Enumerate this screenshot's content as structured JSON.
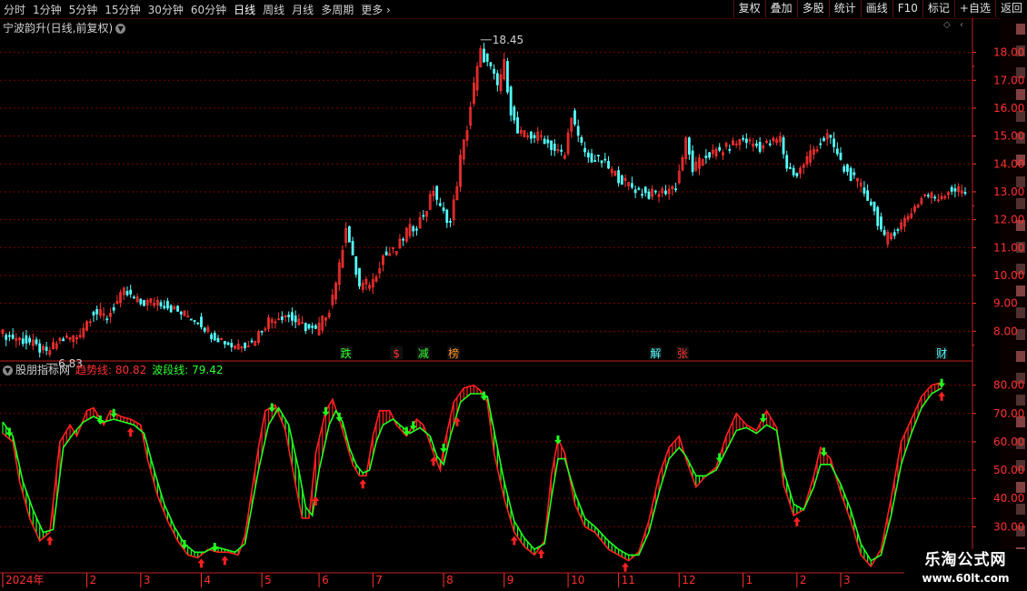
{
  "toolbar": {
    "periods": [
      "分时",
      "1分钟",
      "5分钟",
      "15分钟",
      "30分钟",
      "60分钟",
      "日线",
      "周线",
      "月线",
      "多周期",
      "更多"
    ],
    "active_period": "日线",
    "right_buttons": [
      "复权",
      "叠加",
      "多股",
      "统计",
      "画线",
      "F10",
      "标记",
      "+自选",
      "返回"
    ]
  },
  "main_chart": {
    "title": "宁波韵升(日线,前复权)",
    "max_label": "18.45",
    "min_label": "6.83"
  },
  "sub_chart": {
    "name": "股朋指标网",
    "line1_label": "趋势线:",
    "line1_value": "80.82",
    "line2_label": "波段线:",
    "line2_value": "79.42"
  },
  "logo": {
    "line1": "乐淘公式网",
    "line2": "www.60lt.com"
  },
  "colors": {
    "up": "#ff3232",
    "down": "#54ffff",
    "trend": "#ff2020",
    "wave": "#20ff20",
    "grid": "#800000",
    "axis": "#ff3030"
  },
  "chart_data": [
    {
      "type": "candlestick",
      "title": "宁波韵升(日线,前复权)",
      "y_ticks": [
        8.0,
        9.0,
        10.0,
        11.0,
        12.0,
        13.0,
        14.0,
        15.0,
        16.0,
        17.0,
        18.0
      ],
      "ylim": [
        7.0,
        18.9
      ],
      "annotations": [
        {
          "text": "跌",
          "color": "#30ff30",
          "index": 102
        },
        {
          "text": "$",
          "color": "#ff3030",
          "index": 117
        },
        {
          "text": "减",
          "color": "#30ff30",
          "index": 125
        },
        {
          "text": "榜",
          "color": "#ff9020",
          "index": 134
        },
        {
          "text": "解",
          "color": "#54ffff",
          "index": 194
        },
        {
          "text": "张",
          "color": "#ff3030",
          "index": 202
        },
        {
          "text": "财",
          "color": "#54ffff",
          "index": 279
        }
      ],
      "x_labels": [
        {
          "text": "2024年",
          "index": 0
        },
        {
          "text": "2",
          "index": 25
        },
        {
          "text": "3",
          "index": 41
        },
        {
          "text": "4",
          "index": 59
        },
        {
          "text": "5",
          "index": 77
        },
        {
          "text": "6",
          "index": 94
        },
        {
          "text": "7",
          "index": 110
        },
        {
          "text": "8",
          "index": 131
        },
        {
          "text": "9",
          "index": 149
        },
        {
          "text": "10",
          "index": 168
        },
        {
          "text": "11",
          "index": 183
        },
        {
          "text": "12",
          "index": 201
        },
        {
          "text": "1",
          "index": 220
        },
        {
          "text": "2",
          "index": 236
        },
        {
          "text": "3",
          "index": 249
        }
      ],
      "close_keypoints": [
        [
          0,
          7.9
        ],
        [
          8,
          7.6
        ],
        [
          13,
          7.2
        ],
        [
          17,
          7.7
        ],
        [
          22,
          7.8
        ],
        [
          27,
          8.7
        ],
        [
          31,
          8.5
        ],
        [
          36,
          9.4
        ],
        [
          41,
          9.0
        ],
        [
          46,
          9.1
        ],
        [
          52,
          8.7
        ],
        [
          58,
          8.4
        ],
        [
          62,
          7.9
        ],
        [
          68,
          7.5
        ],
        [
          74,
          7.6
        ],
        [
          79,
          8.4
        ],
        [
          84,
          8.6
        ],
        [
          89,
          8.2
        ],
        [
          93,
          8.0
        ],
        [
          97,
          8.8
        ],
        [
          100,
          10.3
        ],
        [
          102,
          11.8
        ],
        [
          104,
          10.6
        ],
        [
          106,
          9.6
        ],
        [
          110,
          9.8
        ],
        [
          113,
          10.7
        ],
        [
          117,
          10.9
        ],
        [
          120,
          11.6
        ],
        [
          123,
          11.8
        ],
        [
          126,
          12.4
        ],
        [
          128,
          13.1
        ],
        [
          130,
          12.4
        ],
        [
          133,
          11.9
        ],
        [
          135,
          13.3
        ],
        [
          136,
          14.2
        ],
        [
          138,
          15.3
        ],
        [
          140,
          16.8
        ],
        [
          142,
          18.0
        ],
        [
          145,
          17.4
        ],
        [
          147,
          16.8
        ],
        [
          149,
          17.6
        ],
        [
          151,
          15.9
        ],
        [
          153,
          15.1
        ],
        [
          156,
          15.0
        ],
        [
          160,
          15.0
        ],
        [
          164,
          14.5
        ],
        [
          167,
          14.3
        ],
        [
          169,
          15.8
        ],
        [
          171,
          14.9
        ],
        [
          174,
          14.2
        ],
        [
          178,
          14.1
        ],
        [
          183,
          13.5
        ],
        [
          188,
          13.1
        ],
        [
          192,
          12.9
        ],
        [
          196,
          13.0
        ],
        [
          200,
          13.2
        ],
        [
          203,
          14.8
        ],
        [
          205,
          13.8
        ],
        [
          209,
          14.3
        ],
        [
          214,
          14.5
        ],
        [
          220,
          14.9
        ],
        [
          225,
          14.6
        ],
        [
          231,
          14.9
        ],
        [
          233,
          13.9
        ],
        [
          236,
          13.6
        ],
        [
          240,
          14.4
        ],
        [
          245,
          15.0
        ],
        [
          247,
          14.6
        ],
        [
          250,
          13.8
        ],
        [
          255,
          13.2
        ],
        [
          258,
          12.6
        ],
        [
          262,
          11.3
        ],
        [
          266,
          11.7
        ],
        [
          270,
          12.3
        ],
        [
          274,
          12.9
        ],
        [
          278,
          12.8
        ],
        [
          282,
          13.1
        ],
        [
          286,
          13.0
        ]
      ]
    },
    {
      "type": "line",
      "title": "股朋指标网",
      "series": [
        {
          "name": "趋势线",
          "last": 80.82
        },
        {
          "name": "波段线",
          "last": 79.42
        }
      ],
      "y_ticks": [
        30.0,
        40.0,
        50.0,
        60.0,
        70.0,
        80.0
      ],
      "ylim": [
        15,
        86
      ],
      "trend_keypoints": [
        [
          0,
          63
        ],
        [
          3,
          60
        ],
        [
          5,
          46
        ],
        [
          8,
          33
        ],
        [
          11,
          25
        ],
        [
          14,
          28
        ],
        [
          17,
          60
        ],
        [
          20,
          66
        ],
        [
          22,
          62
        ],
        [
          25,
          71
        ],
        [
          27,
          72
        ],
        [
          30,
          66
        ],
        [
          32,
          71
        ],
        [
          35,
          69
        ],
        [
          38,
          68
        ],
        [
          41,
          66
        ],
        [
          43,
          54
        ],
        [
          46,
          41
        ],
        [
          49,
          32
        ],
        [
          52,
          25
        ],
        [
          55,
          20
        ],
        [
          58,
          19
        ],
        [
          61,
          22
        ],
        [
          64,
          21
        ],
        [
          67,
          21
        ],
        [
          70,
          20
        ],
        [
          72,
          27
        ],
        [
          76,
          58
        ],
        [
          78,
          71
        ],
        [
          81,
          73
        ],
        [
          84,
          64
        ],
        [
          87,
          45
        ],
        [
          89,
          33
        ],
        [
          91,
          33
        ],
        [
          93,
          56
        ],
        [
          96,
          71
        ],
        [
          98,
          75
        ],
        [
          100,
          68
        ],
        [
          102,
          60
        ],
        [
          104,
          52
        ],
        [
          106,
          48
        ],
        [
          108,
          48
        ],
        [
          110,
          62
        ],
        [
          112,
          71
        ],
        [
          115,
          71
        ],
        [
          117,
          66
        ],
        [
          120,
          62
        ],
        [
          123,
          68
        ],
        [
          125,
          66
        ],
        [
          128,
          56
        ],
        [
          130,
          50
        ],
        [
          131,
          58
        ],
        [
          134,
          74
        ],
        [
          137,
          79
        ],
        [
          140,
          80
        ],
        [
          142,
          78
        ],
        [
          144,
          74
        ],
        [
          146,
          56
        ],
        [
          149,
          40
        ],
        [
          152,
          28
        ],
        [
          155,
          23
        ],
        [
          158,
          20
        ],
        [
          161,
          25
        ],
        [
          163,
          48
        ],
        [
          165,
          61
        ],
        [
          167,
          56
        ],
        [
          170,
          38
        ],
        [
          173,
          30
        ],
        [
          176,
          28
        ],
        [
          180,
          22
        ],
        [
          183,
          20
        ],
        [
          186,
          18
        ],
        [
          189,
          21
        ],
        [
          192,
          32
        ],
        [
          195,
          48
        ],
        [
          198,
          58
        ],
        [
          201,
          62
        ],
        [
          203,
          54
        ],
        [
          206,
          44
        ],
        [
          209,
          48
        ],
        [
          212,
          51
        ],
        [
          215,
          62
        ],
        [
          218,
          70
        ],
        [
          221,
          66
        ],
        [
          224,
          64
        ],
        [
          227,
          71
        ],
        [
          230,
          65
        ],
        [
          232,
          45
        ],
        [
          235,
          34
        ],
        [
          238,
          36
        ],
        [
          241,
          48
        ],
        [
          243,
          58
        ],
        [
          246,
          54
        ],
        [
          249,
          42
        ],
        [
          252,
          32
        ],
        [
          255,
          20
        ],
        [
          258,
          16
        ],
        [
          261,
          22
        ],
        [
          264,
          40
        ],
        [
          267,
          60
        ],
        [
          270,
          68
        ],
        [
          273,
          76
        ],
        [
          276,
          80
        ],
        [
          279,
          81
        ]
      ],
      "wave_keypoints": [
        [
          0,
          67
        ],
        [
          3,
          62
        ],
        [
          6,
          46
        ],
        [
          9,
          36
        ],
        [
          12,
          28
        ],
        [
          15,
          29
        ],
        [
          18,
          58
        ],
        [
          21,
          63
        ],
        [
          24,
          67
        ],
        [
          27,
          69
        ],
        [
          30,
          67
        ],
        [
          33,
          68
        ],
        [
          36,
          67
        ],
        [
          39,
          66
        ],
        [
          42,
          63
        ],
        [
          45,
          50
        ],
        [
          48,
          38
        ],
        [
          51,
          30
        ],
        [
          54,
          24
        ],
        [
          57,
          21
        ],
        [
          60,
          21
        ],
        [
          63,
          23
        ],
        [
          66,
          22
        ],
        [
          69,
          21
        ],
        [
          72,
          24
        ],
        [
          76,
          50
        ],
        [
          79,
          66
        ],
        [
          82,
          72
        ],
        [
          85,
          66
        ],
        [
          88,
          50
        ],
        [
          90,
          37
        ],
        [
          92,
          34
        ],
        [
          94,
          50
        ],
        [
          97,
          66
        ],
        [
          99,
          71
        ],
        [
          101,
          67
        ],
        [
          103,
          58
        ],
        [
          105,
          52
        ],
        [
          107,
          49
        ],
        [
          109,
          50
        ],
        [
          111,
          60
        ],
        [
          113,
          66
        ],
        [
          116,
          68
        ],
        [
          118,
          66
        ],
        [
          121,
          63
        ],
        [
          124,
          65
        ],
        [
          127,
          62
        ],
        [
          129,
          55
        ],
        [
          131,
          52
        ],
        [
          133,
          62
        ],
        [
          136,
          74
        ],
        [
          139,
          77
        ],
        [
          142,
          77
        ],
        [
          144,
          76
        ],
        [
          146,
          64
        ],
        [
          149,
          46
        ],
        [
          152,
          32
        ],
        [
          155,
          26
        ],
        [
          158,
          22
        ],
        [
          161,
          24
        ],
        [
          163,
          40
        ],
        [
          165,
          54
        ],
        [
          167,
          54
        ],
        [
          170,
          42
        ],
        [
          173,
          33
        ],
        [
          176,
          30
        ],
        [
          180,
          25
        ],
        [
          183,
          22
        ],
        [
          186,
          20
        ],
        [
          189,
          20
        ],
        [
          192,
          28
        ],
        [
          195,
          42
        ],
        [
          198,
          54
        ],
        [
          201,
          58
        ],
        [
          203,
          55
        ],
        [
          206,
          48
        ],
        [
          209,
          48
        ],
        [
          212,
          50
        ],
        [
          215,
          57
        ],
        [
          218,
          64
        ],
        [
          221,
          65
        ],
        [
          224,
          63
        ],
        [
          227,
          66
        ],
        [
          230,
          64
        ],
        [
          232,
          50
        ],
        [
          235,
          38
        ],
        [
          238,
          36
        ],
        [
          241,
          44
        ],
        [
          243,
          52
        ],
        [
          246,
          52
        ],
        [
          249,
          45
        ],
        [
          252,
          36
        ],
        [
          255,
          24
        ],
        [
          258,
          18
        ],
        [
          261,
          20
        ],
        [
          264,
          34
        ],
        [
          267,
          52
        ],
        [
          270,
          63
        ],
        [
          273,
          72
        ],
        [
          276,
          77
        ],
        [
          279,
          79
        ]
      ],
      "up_arrow_indices": [
        14,
        38,
        59,
        66,
        93,
        107,
        128,
        135,
        152,
        160,
        185,
        236,
        281
      ],
      "down_arrow_indices": [
        2,
        29,
        33,
        54,
        63,
        80,
        96,
        100,
        120,
        122,
        131,
        143,
        165,
        213,
        226,
        244,
        279
      ]
    }
  ]
}
